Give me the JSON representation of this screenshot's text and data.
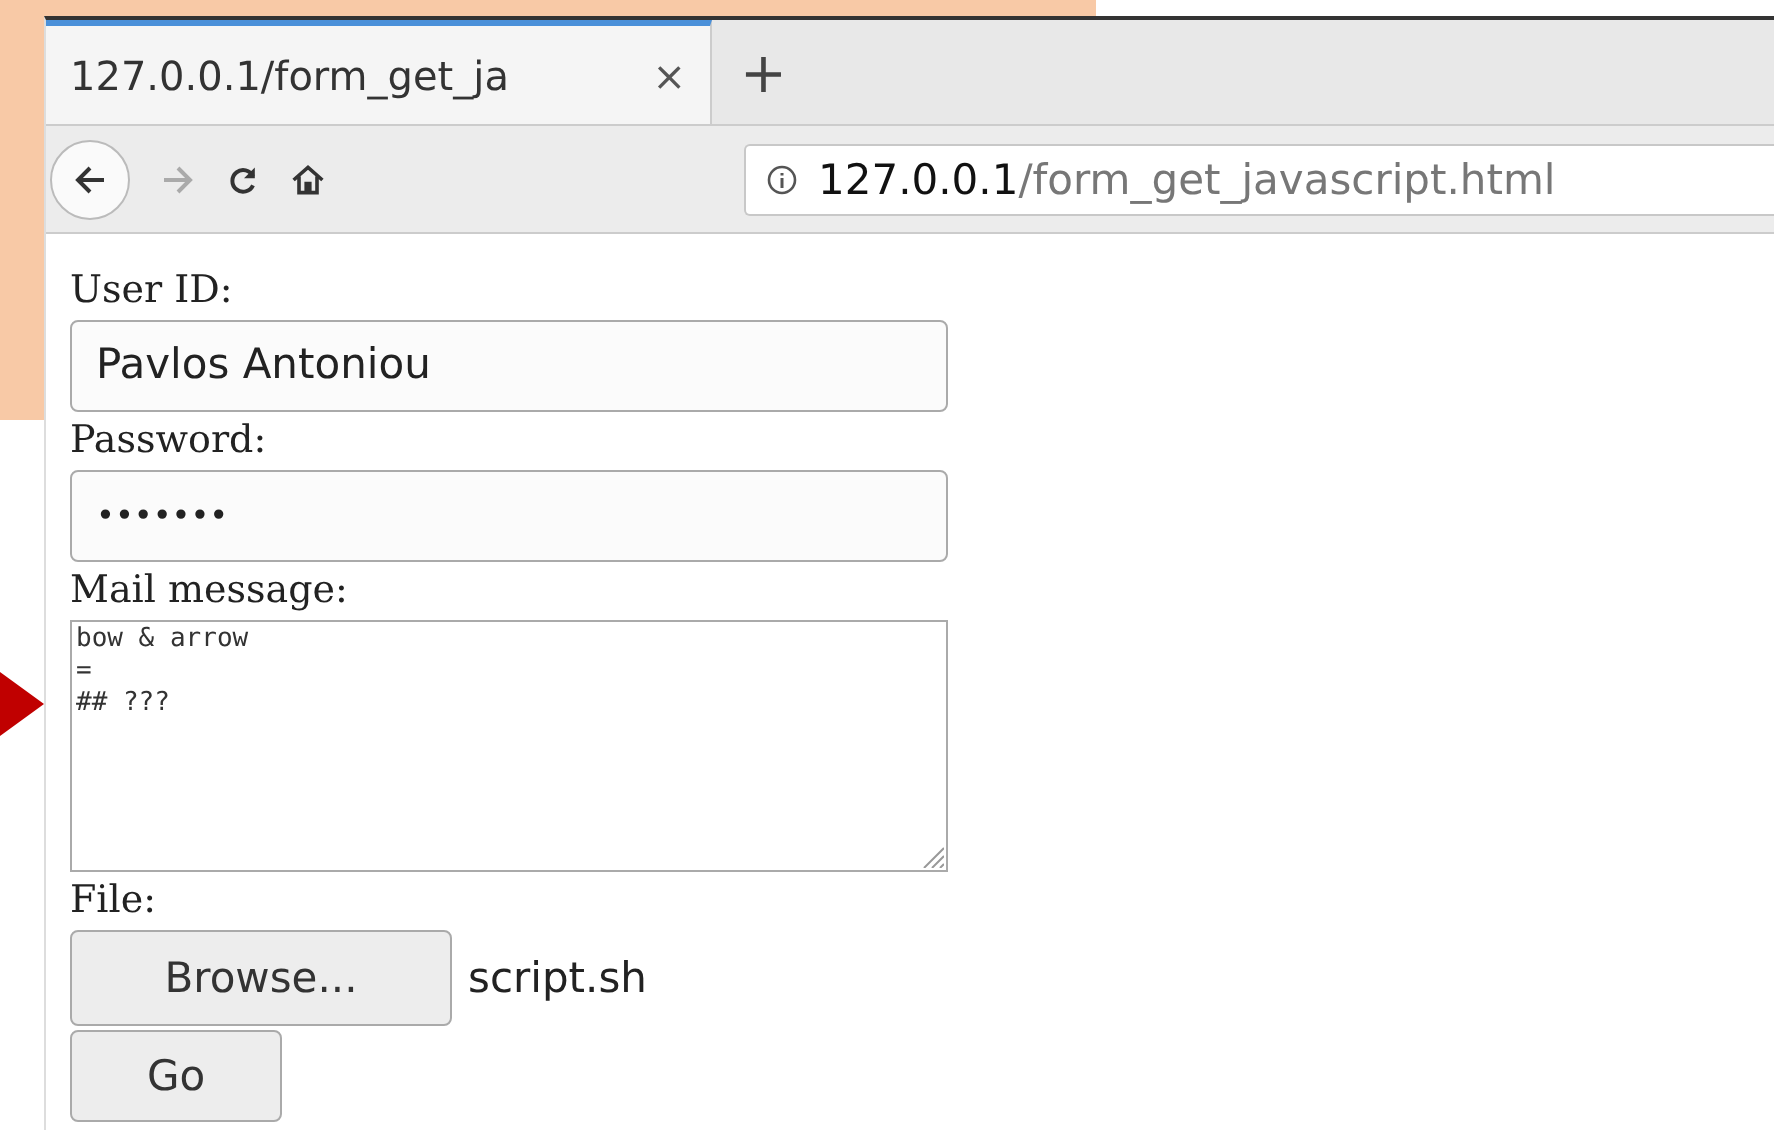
{
  "tabs": [
    {
      "label": "127.0.0.1/form_get_ja",
      "selected": true
    }
  ],
  "new_tab": "+",
  "close_tab": "×",
  "address_bar": {
    "host": "127.0.0.1",
    "path": "/form_get_javascript.html"
  },
  "form": {
    "fields": [
      {
        "kind": "text",
        "label": "User ID:",
        "value": "Pavlos Antoniou"
      },
      {
        "kind": "password",
        "label": "Password:",
        "value": "•••••••"
      },
      {
        "kind": "textarea",
        "label": "Mail message:",
        "value": "bow & arrow\n=\n## ???"
      },
      {
        "kind": "file",
        "label": "File:",
        "button": "Browse...",
        "file_name": "script.sh"
      }
    ],
    "submit": "Go"
  }
}
